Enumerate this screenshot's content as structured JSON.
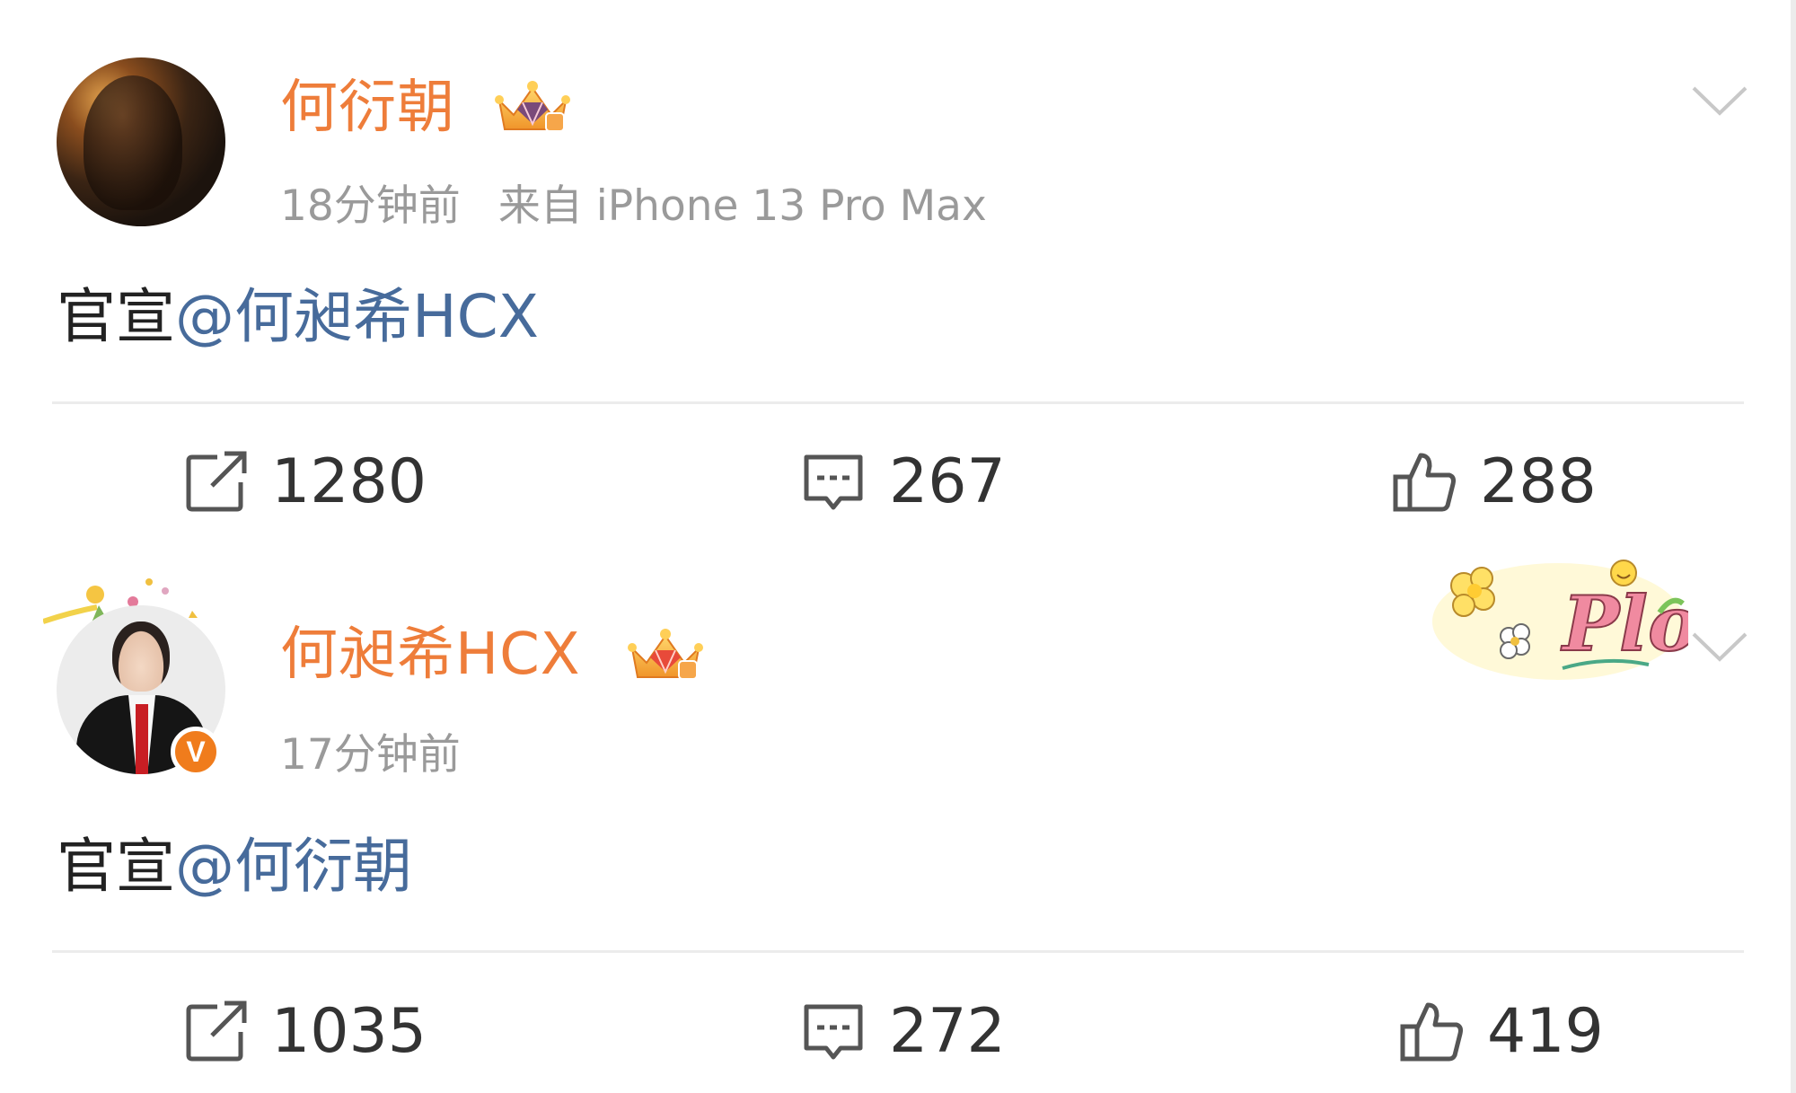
{
  "posts": [
    {
      "username": "何衍朝",
      "timestamp": "18分钟前",
      "source": "来自 iPhone 13 Pro Max",
      "content_prefix": "官宣",
      "mention": "@何昶希HCX",
      "reposts": "1280",
      "comments": "267",
      "likes": "288",
      "vip_icon": "crown-icon",
      "avatar": "user-avatar"
    },
    {
      "username": "何昶希HCX",
      "timestamp": "17分钟前",
      "content_prefix": "官宣",
      "mention": "@何衍朝",
      "reposts": "1035",
      "comments": "272",
      "likes": "419",
      "vip_icon": "crown-icon",
      "verified_badge": "V",
      "sticker_text": "Plog"
    }
  ],
  "colors": {
    "username": "#ee7d3a",
    "mention": "#476b9b",
    "meta": "#9a9a9a",
    "body_text": "#222222",
    "divider": "#ececec",
    "verified": "#f07c1c"
  }
}
